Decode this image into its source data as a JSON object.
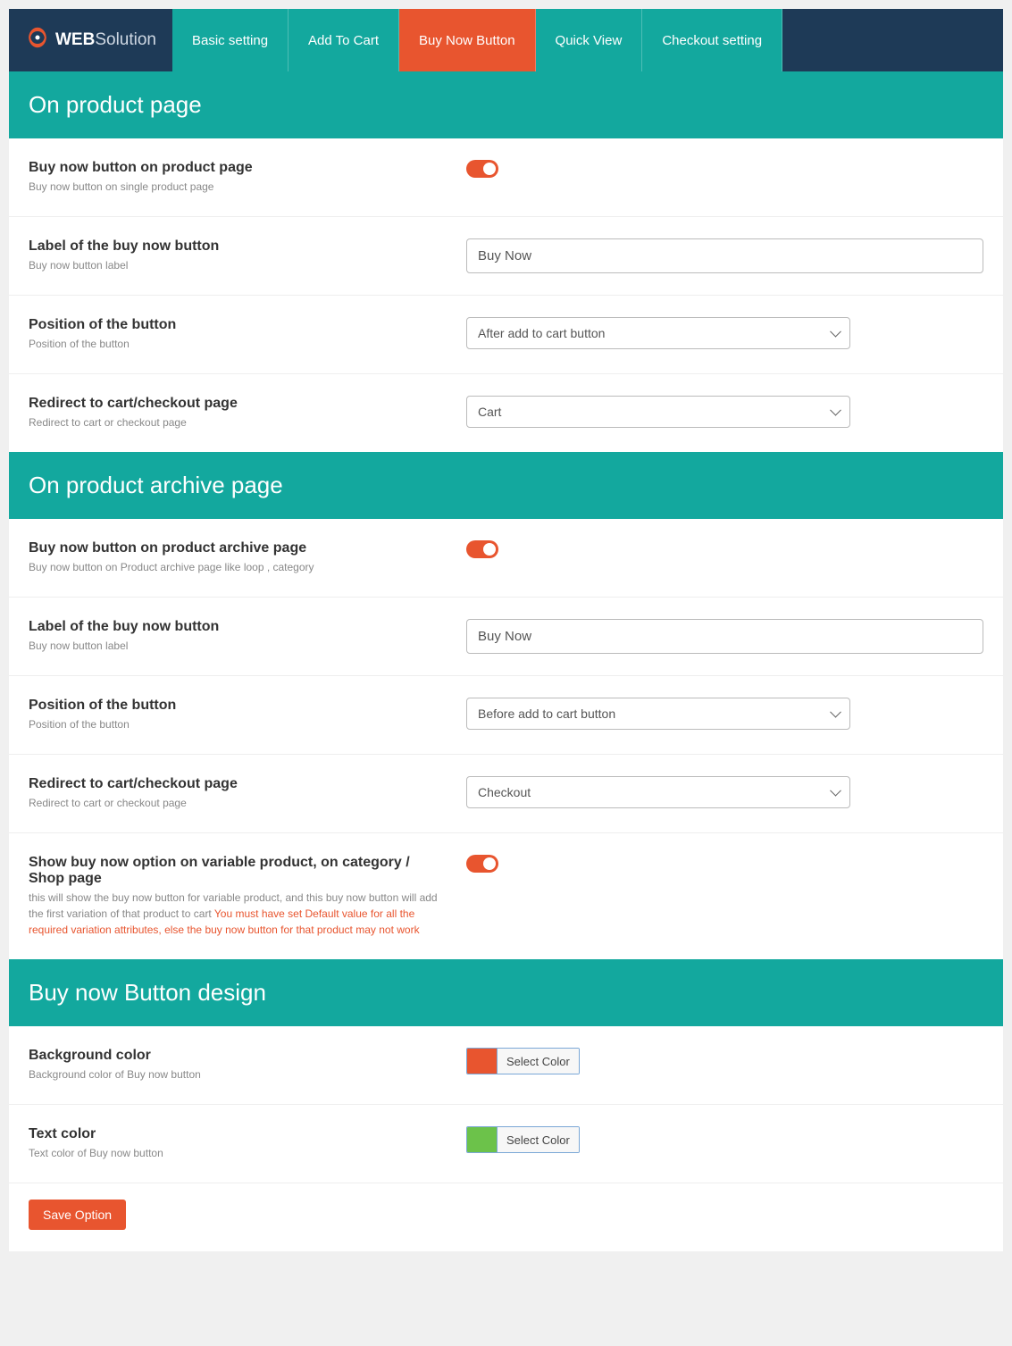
{
  "brand": {
    "bold": "WEB",
    "light": "Solution"
  },
  "tabs": [
    {
      "label": "Basic setting",
      "active": false
    },
    {
      "label": "Add To Cart",
      "active": false
    },
    {
      "label": "Buy Now Button",
      "active": true
    },
    {
      "label": "Quick View",
      "active": false
    },
    {
      "label": "Checkout setting",
      "active": false
    }
  ],
  "sections": {
    "product_page": {
      "heading": "On product page",
      "enable": {
        "title": "Buy now button on product page",
        "desc": "Buy now button on single product page",
        "value": true
      },
      "label": {
        "title": "Label of the buy now button",
        "desc": "Buy now button label",
        "value": "Buy Now"
      },
      "position": {
        "title": "Position of the button",
        "desc": "Position of the button",
        "value": "After add to cart button"
      },
      "redirect": {
        "title": "Redirect to cart/checkout page",
        "desc": "Redirect to cart or checkout page",
        "value": "Cart"
      }
    },
    "archive_page": {
      "heading": "On product archive page",
      "enable": {
        "title": "Buy now button on product archive page",
        "desc": "Buy now button on Product archive page like loop , category",
        "value": true
      },
      "label": {
        "title": "Label of the buy now button",
        "desc": "Buy now button label",
        "value": "Buy Now"
      },
      "position": {
        "title": "Position of the button",
        "desc": "Position of the button",
        "value": "Before add to cart button"
      },
      "redirect": {
        "title": "Redirect to cart/checkout page",
        "desc": "Redirect to cart or checkout page",
        "value": "Checkout"
      },
      "variable": {
        "title": "Show buy now option on variable product, on category / Shop page",
        "desc": "this will show the buy now button for variable product, and this buy now button will add the first variation of that product to cart ",
        "warn": "You must have set Default value for all the required variation attributes, else the buy now button for that product may not work",
        "value": true
      }
    },
    "design": {
      "heading": "Buy now Button design",
      "bg": {
        "title": "Background color",
        "desc": "Background color of Buy now button",
        "swatch": "#e8552f",
        "button_label": "Select Color"
      },
      "text": {
        "title": "Text color",
        "desc": "Text color of Buy now button",
        "swatch": "#6cc24a",
        "button_label": "Select Color"
      }
    }
  },
  "save_label": "Save Option"
}
